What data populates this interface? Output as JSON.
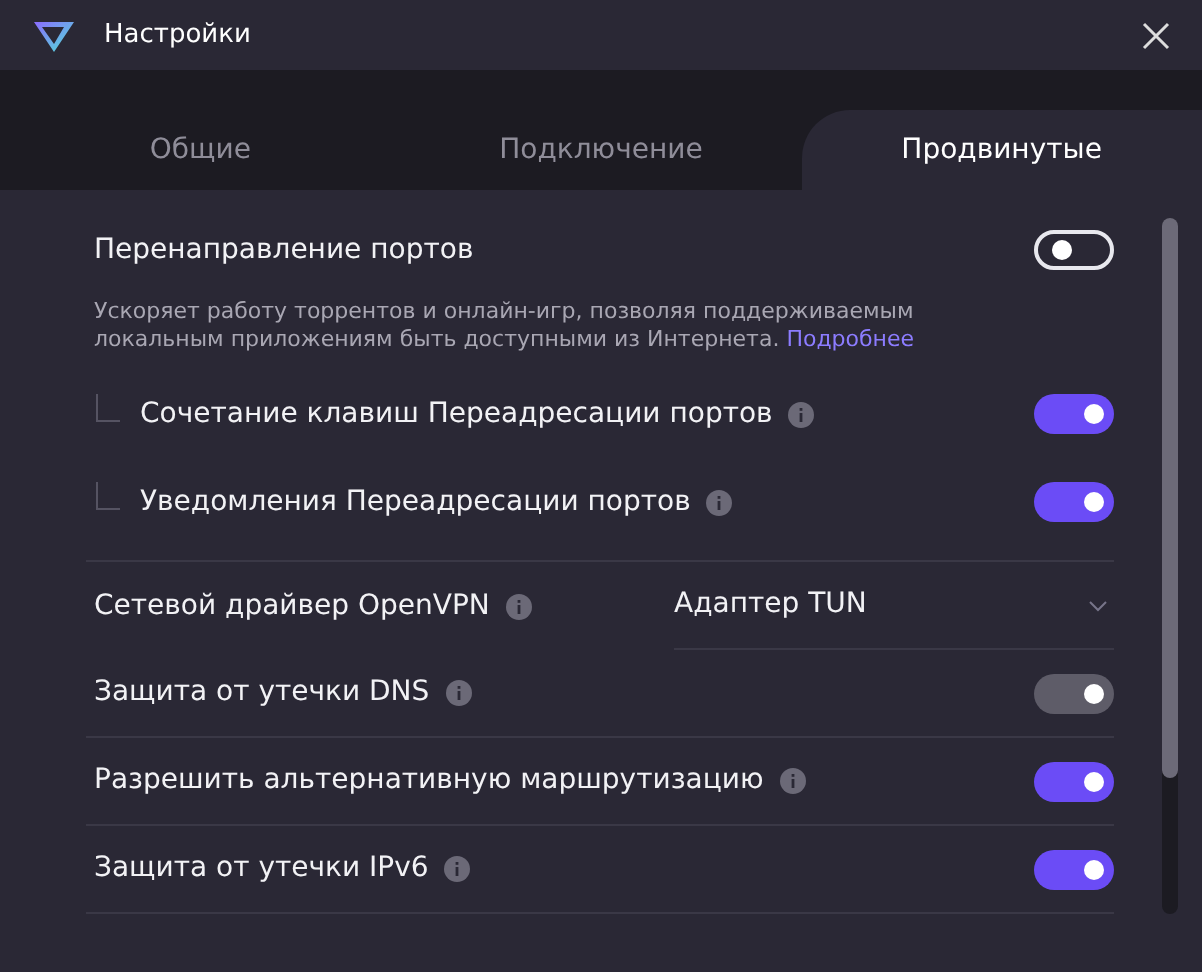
{
  "window": {
    "title": "Настройки"
  },
  "tabs": [
    {
      "label": "Общие",
      "selected": false
    },
    {
      "label": "Подключение",
      "selected": false
    },
    {
      "label": "Продвинутые",
      "selected": true
    }
  ],
  "port_forwarding": {
    "label": "Перенаправление портов",
    "on": false,
    "description": "Ускоряет работу торрентов и онлайн-игр, позволяя поддерживаемым локальным приложениям быть доступными из Интернета.",
    "link": "Подробнее",
    "children": [
      {
        "label": "Сочетание клавиш Переадресации портов",
        "info": true,
        "on": true,
        "disabled": false
      },
      {
        "label": "Уведомления Переадресации портов",
        "info": true,
        "on": true,
        "disabled": false
      }
    ]
  },
  "settings": [
    {
      "kind": "select",
      "label": "Сетевой драйвер OpenVPN",
      "info": true,
      "value": "Адаптер TUN"
    },
    {
      "kind": "toggle",
      "label": "Защита от утечки DNS",
      "info": true,
      "on": true,
      "disabled": true
    },
    {
      "kind": "toggle",
      "label": "Разрешить альтернативную маршрутизацию",
      "info": true,
      "on": true,
      "disabled": false
    },
    {
      "kind": "toggle",
      "label": "Защита от утечки IPv6",
      "info": true,
      "on": true,
      "disabled": false
    }
  ]
}
